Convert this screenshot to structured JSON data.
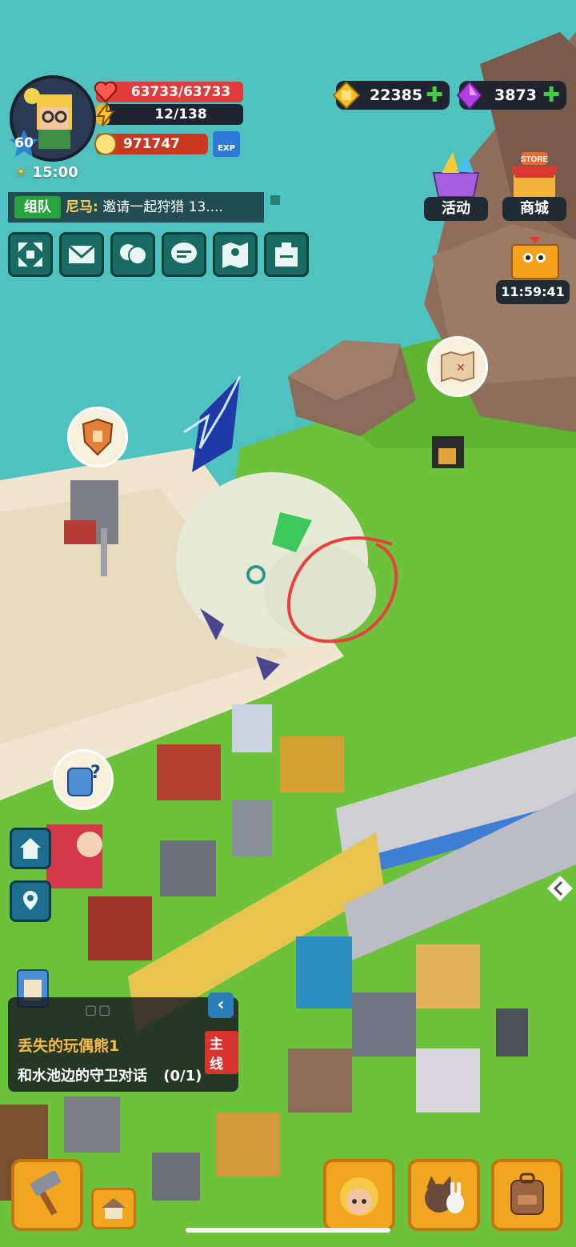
{
  "player": {
    "level": "60",
    "hp": "63733/63733",
    "energy": "12/138",
    "power": "971747",
    "exp_label": "EXP",
    "time": "15:00"
  },
  "chat": {
    "tag": "组队",
    "sender": "尼马:",
    "message": "邀请一起狩猎 13...."
  },
  "currency": {
    "gold": "22385",
    "gems": "3873"
  },
  "shop": {
    "activity_label": "活动",
    "store_label": "商城",
    "store_sign": "STORE",
    "timer": "11:59:41"
  },
  "quest": {
    "title": "丢失的玩偶熊1",
    "tag": "主线",
    "description": "和水池边的守卫对话",
    "progress": "(0/1)"
  },
  "icons": [
    "fullscreen-icon",
    "mail-icon",
    "friends-icon",
    "chat-icon",
    "map-icon",
    "task-board-icon"
  ],
  "colors": {
    "hp_bar": "#e23b3b",
    "power_bar": "#c9381f",
    "accent_gold": "#f2a51e",
    "gem_purple": "#b43de6",
    "plus_green": "#3fcf3f"
  }
}
